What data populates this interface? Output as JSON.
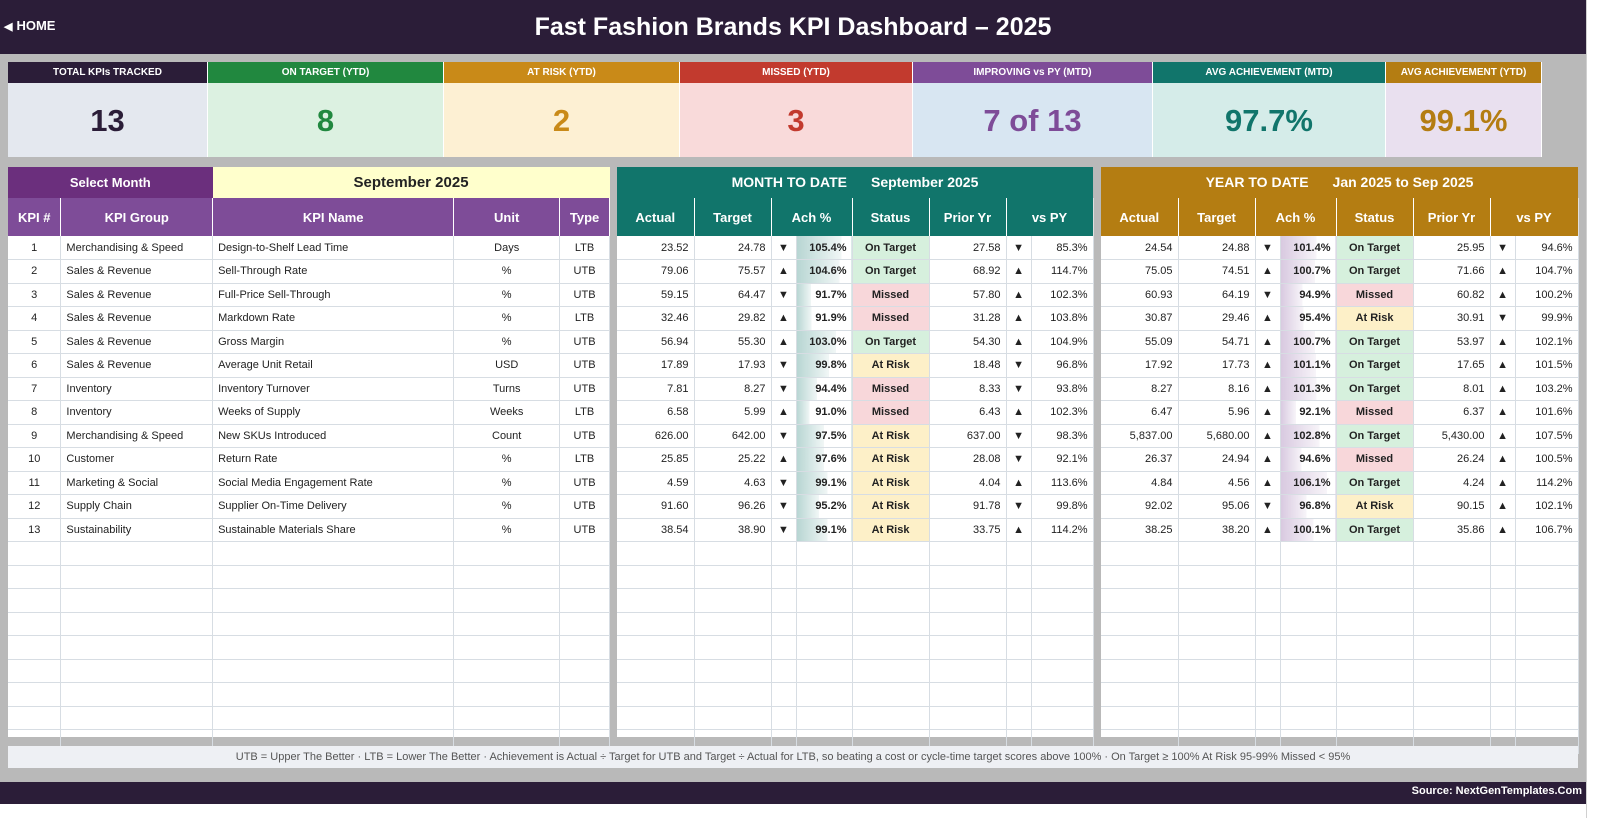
{
  "header": {
    "home_label": "HOME",
    "title": "Fast Fashion Brands KPI Dashboard   –   2025"
  },
  "colors": {
    "header_bg": "#2b1d38",
    "purple": "#7e4c98",
    "teal": "#11756b",
    "gold": "#b47d12",
    "on_target": "#1e8a3c",
    "missed": "#c62828"
  },
  "cards": [
    {
      "label": "TOTAL KPIs TRACKED",
      "value": "13",
      "head": "#2b1d38",
      "bg": "#e4e8ef",
      "fg": "#2b1d38"
    },
    {
      "label": "ON TARGET (YTD)",
      "value": "8",
      "head": "#21883f",
      "bg": "#dcf1e1",
      "fg": "#21883f"
    },
    {
      "label": "AT RISK (YTD)",
      "value": "2",
      "head": "#c98a18",
      "bg": "#fdf0d3",
      "fg": "#c98a18"
    },
    {
      "label": "MISSED (YTD)",
      "value": "3",
      "head": "#c23a2e",
      "bg": "#f9dada",
      "fg": "#c23a2e"
    },
    {
      "label": "IMPROVING vs PY (MTD)",
      "value": "7 of 13",
      "head": "#7e4c98",
      "bg": "#d8e6f2",
      "fg": "#7e4c98"
    },
    {
      "label": "AVG ACHIEVEMENT (MTD)",
      "value": "97.7%",
      "head": "#11756b",
      "bg": "#d5ece9",
      "fg": "#11756b"
    },
    {
      "label": "AVG ACHIEVEMENT (YTD)",
      "value": "99.1%",
      "head": "#b47d12",
      "bg": "#e9e0ef",
      "fg": "#b47d12"
    }
  ],
  "selector": {
    "label": "Select Month",
    "value": "September 2025"
  },
  "left_headers": [
    "KPI #",
    "KPI Group",
    "KPI Name",
    "Unit",
    "Type"
  ],
  "mtd": {
    "banner": "MONTH TO DATE",
    "period": "September 2025"
  },
  "ytd": {
    "banner": "YEAR TO DATE",
    "period": "Jan 2025  to  Sep 2025"
  },
  "metric_headers": [
    "Actual",
    "Target",
    "Ach %",
    "Status",
    "Prior Yr",
    "vs PY"
  ],
  "rows": [
    {
      "id": "1",
      "group": "Merchandising & Speed",
      "name": "Design-to-Shelf Lead Time",
      "unit": "Days",
      "type": "LTB",
      "mtd": {
        "actual": "23.52",
        "target": "24.78",
        "ach_dir": "down",
        "ach": "105.4%",
        "status": "On Target",
        "prior": "27.58",
        "py_dir": "down",
        "vs_py": "85.3%"
      },
      "ytd": {
        "actual": "24.54",
        "target": "24.88",
        "ach_dir": "down",
        "ach": "101.4%",
        "status": "On Target",
        "prior": "25.95",
        "py_dir": "down",
        "vs_py": "94.6%"
      }
    },
    {
      "id": "2",
      "group": "Sales & Revenue",
      "name": "Sell-Through Rate",
      "unit": "%",
      "type": "UTB",
      "mtd": {
        "actual": "79.06",
        "target": "75.57",
        "ach_dir": "up",
        "ach": "104.6%",
        "status": "On Target",
        "prior": "68.92",
        "py_dir": "up",
        "vs_py": "114.7%"
      },
      "ytd": {
        "actual": "75.05",
        "target": "74.51",
        "ach_dir": "up",
        "ach": "100.7%",
        "status": "On Target",
        "prior": "71.66",
        "py_dir": "up",
        "vs_py": "104.7%"
      }
    },
    {
      "id": "3",
      "group": "Sales & Revenue",
      "name": "Full-Price Sell-Through",
      "unit": "%",
      "type": "UTB",
      "mtd": {
        "actual": "59.15",
        "target": "64.47",
        "ach_dir": "down",
        "ach": "91.7%",
        "status": "Missed",
        "prior": "57.80",
        "py_dir": "up",
        "vs_py": "102.3%"
      },
      "ytd": {
        "actual": "60.93",
        "target": "64.19",
        "ach_dir": "down",
        "ach": "94.9%",
        "status": "Missed",
        "prior": "60.82",
        "py_dir": "up",
        "vs_py": "100.2%"
      }
    },
    {
      "id": "4",
      "group": "Sales & Revenue",
      "name": "Markdown Rate",
      "unit": "%",
      "type": "LTB",
      "mtd": {
        "actual": "32.46",
        "target": "29.82",
        "ach_dir": "up",
        "ach": "91.9%",
        "status": "Missed",
        "prior": "31.28",
        "py_dir": "up",
        "vs_py": "103.8%"
      },
      "ytd": {
        "actual": "30.87",
        "target": "29.46",
        "ach_dir": "up",
        "ach": "95.4%",
        "status": "At Risk",
        "prior": "30.91",
        "py_dir": "down",
        "vs_py": "99.9%"
      }
    },
    {
      "id": "5",
      "group": "Sales & Revenue",
      "name": "Gross Margin",
      "unit": "%",
      "type": "UTB",
      "mtd": {
        "actual": "56.94",
        "target": "55.30",
        "ach_dir": "up",
        "ach": "103.0%",
        "status": "On Target",
        "prior": "54.30",
        "py_dir": "up",
        "vs_py": "104.9%"
      },
      "ytd": {
        "actual": "55.09",
        "target": "54.71",
        "ach_dir": "up",
        "ach": "100.7%",
        "status": "On Target",
        "prior": "53.97",
        "py_dir": "up",
        "vs_py": "102.1%"
      }
    },
    {
      "id": "6",
      "group": "Sales & Revenue",
      "name": "Average Unit Retail",
      "unit": "USD",
      "type": "UTB",
      "mtd": {
        "actual": "17.89",
        "target": "17.93",
        "ach_dir": "down",
        "ach": "99.8%",
        "status": "At Risk",
        "prior": "18.48",
        "py_dir": "down",
        "vs_py": "96.8%"
      },
      "ytd": {
        "actual": "17.92",
        "target": "17.73",
        "ach_dir": "up",
        "ach": "101.1%",
        "status": "On Target",
        "prior": "17.65",
        "py_dir": "up",
        "vs_py": "101.5%"
      }
    },
    {
      "id": "7",
      "group": "Inventory",
      "name": "Inventory Turnover",
      "unit": "Turns",
      "type": "UTB",
      "mtd": {
        "actual": "7.81",
        "target": "8.27",
        "ach_dir": "down",
        "ach": "94.4%",
        "status": "Missed",
        "prior": "8.33",
        "py_dir": "down",
        "vs_py": "93.8%"
      },
      "ytd": {
        "actual": "8.27",
        "target": "8.16",
        "ach_dir": "up",
        "ach": "101.3%",
        "status": "On Target",
        "prior": "8.01",
        "py_dir": "up",
        "vs_py": "103.2%"
      }
    },
    {
      "id": "8",
      "group": "Inventory",
      "name": "Weeks of Supply",
      "unit": "Weeks",
      "type": "LTB",
      "mtd": {
        "actual": "6.58",
        "target": "5.99",
        "ach_dir": "up",
        "ach": "91.0%",
        "status": "Missed",
        "prior": "6.43",
        "py_dir": "up",
        "vs_py": "102.3%"
      },
      "ytd": {
        "actual": "6.47",
        "target": "5.96",
        "ach_dir": "up",
        "ach": "92.1%",
        "status": "Missed",
        "prior": "6.37",
        "py_dir": "up",
        "vs_py": "101.6%"
      }
    },
    {
      "id": "9",
      "group": "Merchandising & Speed",
      "name": "New SKUs Introduced",
      "unit": "Count",
      "type": "UTB",
      "mtd": {
        "actual": "626.00",
        "target": "642.00",
        "ach_dir": "down",
        "ach": "97.5%",
        "status": "At Risk",
        "prior": "637.00",
        "py_dir": "down",
        "vs_py": "98.3%"
      },
      "ytd": {
        "actual": "5,837.00",
        "target": "5,680.00",
        "ach_dir": "up",
        "ach": "102.8%",
        "status": "On Target",
        "prior": "5,430.00",
        "py_dir": "up",
        "vs_py": "107.5%"
      }
    },
    {
      "id": "10",
      "group": "Customer",
      "name": "Return Rate",
      "unit": "%",
      "type": "LTB",
      "mtd": {
        "actual": "25.85",
        "target": "25.22",
        "ach_dir": "up",
        "ach": "97.6%",
        "status": "At Risk",
        "prior": "28.08",
        "py_dir": "down",
        "vs_py": "92.1%"
      },
      "ytd": {
        "actual": "26.37",
        "target": "24.94",
        "ach_dir": "up",
        "ach": "94.6%",
        "status": "Missed",
        "prior": "26.24",
        "py_dir": "up",
        "vs_py": "100.5%"
      }
    },
    {
      "id": "11",
      "group": "Marketing & Social",
      "name": "Social Media Engagement Rate",
      "unit": "%",
      "type": "UTB",
      "mtd": {
        "actual": "4.59",
        "target": "4.63",
        "ach_dir": "down",
        "ach": "99.1%",
        "status": "At Risk",
        "prior": "4.04",
        "py_dir": "up",
        "vs_py": "113.6%"
      },
      "ytd": {
        "actual": "4.84",
        "target": "4.56",
        "ach_dir": "up",
        "ach": "106.1%",
        "status": "On Target",
        "prior": "4.24",
        "py_dir": "up",
        "vs_py": "114.2%"
      }
    },
    {
      "id": "12",
      "group": "Supply Chain",
      "name": "Supplier On-Time Delivery",
      "unit": "%",
      "type": "UTB",
      "mtd": {
        "actual": "91.60",
        "target": "96.26",
        "ach_dir": "down",
        "ach": "95.2%",
        "status": "At Risk",
        "prior": "91.78",
        "py_dir": "down",
        "vs_py": "99.8%"
      },
      "ytd": {
        "actual": "92.02",
        "target": "95.06",
        "ach_dir": "down",
        "ach": "96.8%",
        "status": "At Risk",
        "prior": "90.15",
        "py_dir": "up",
        "vs_py": "102.1%"
      }
    },
    {
      "id": "13",
      "group": "Sustainability",
      "name": "Sustainable Materials Share",
      "unit": "%",
      "type": "UTB",
      "mtd": {
        "actual": "38.54",
        "target": "38.90",
        "ach_dir": "down",
        "ach": "99.1%",
        "status": "At Risk",
        "prior": "33.75",
        "py_dir": "up",
        "vs_py": "114.2%"
      },
      "ytd": {
        "actual": "38.25",
        "target": "38.20",
        "ach_dir": "up",
        "ach": "100.1%",
        "status": "On Target",
        "prior": "35.86",
        "py_dir": "up",
        "vs_py": "106.7%"
      }
    }
  ],
  "footnote": "UTB = Upper The Better   ·   LTB = Lower The Better   ·   Achievement is Actual ÷ Target for UTB and Target ÷ Actual for LTB, so beating a cost or cycle-time target scores above 100%   ·   On Target ≥ 100%     At Risk 95-99%     Missed < 95%",
  "source": "Source: NextGenTemplates.Com"
}
